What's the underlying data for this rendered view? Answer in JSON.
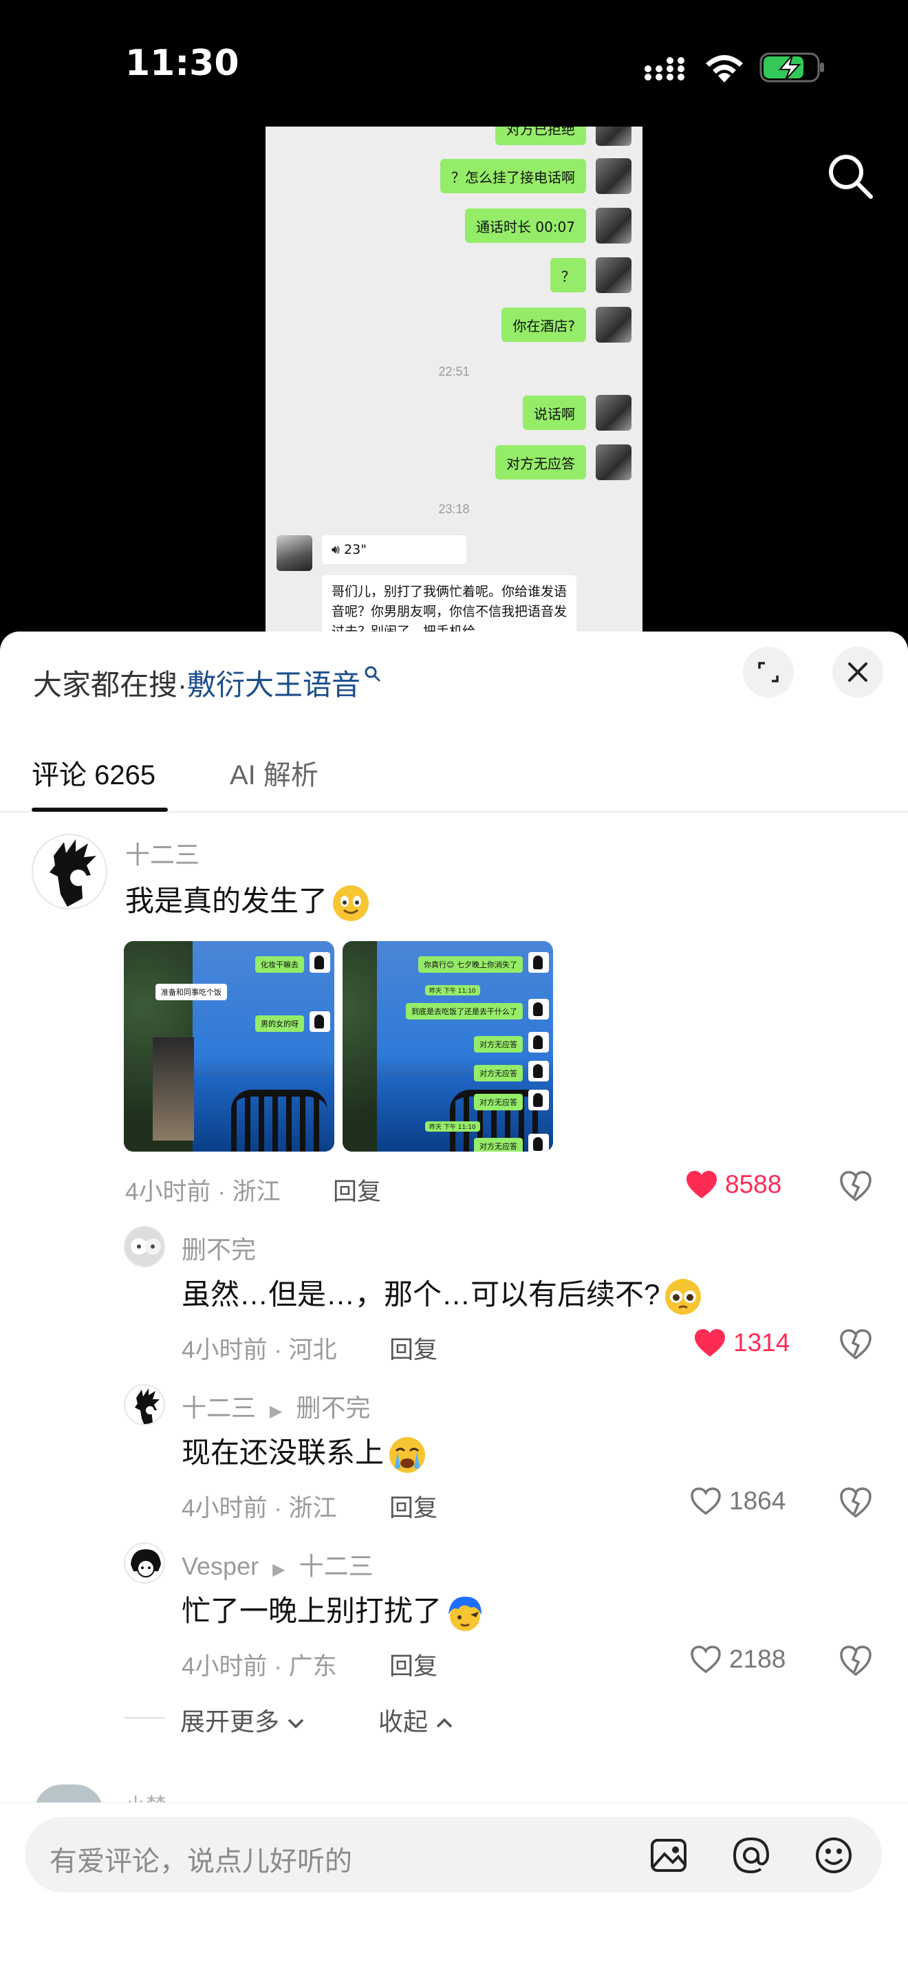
{
  "status": {
    "time": "11:30"
  },
  "video": {
    "messages_right": [
      {
        "text": "对方已拒绝"
      },
      {
        "text": "？怎么挂了接电话啊"
      },
      {
        "text": "通话时长 00:07"
      },
      {
        "text": "？"
      },
      {
        "text": "你在酒店?"
      },
      {
        "text": "说话啊"
      },
      {
        "text": "对方无应答"
      }
    ],
    "times": [
      "22:51",
      "23:18"
    ],
    "voice": "23\"",
    "left_message": "哥们儿，别打了我俩忙着呢。你给谁发语音呢？你男朋友啊，你信不信我把语音发过去？别闹了，把手机给"
  },
  "search_hint": {
    "prefix": "大家都在搜·",
    "keyword": "敷衍大王语音"
  },
  "tabs": [
    {
      "label": "评论 6265",
      "active": true
    },
    {
      "label": "AI 解析",
      "active": false
    }
  ],
  "comments": {
    "main": {
      "user": "十二三",
      "text": "我是真的发生了",
      "meta": "4小时前 · 浙江",
      "reply": "回复",
      "likes": "8588",
      "thumb1": {
        "msgs": [
          "化妆干嘛去",
          "准备和同事吃个饭",
          "男的女的呀"
        ]
      },
      "thumb2": {
        "msgs": [
          "你真行😊 七夕晚上你消失了",
          "昨天 下午 11:10",
          "到底是去吃饭了还是去干什么了",
          "对方无应答",
          "对方无应答",
          "对方无应答",
          "昨天 下午 11:10",
          "对方无应答"
        ]
      }
    },
    "replies": [
      {
        "user": "删不完",
        "to": "",
        "text": "虽然…但是…，那个…可以有后续不?",
        "meta": "4小时前 · 河北",
        "reply": "回复",
        "likes": "1314",
        "liked": true
      },
      {
        "user": "十二三",
        "to": "删不完",
        "text": "现在还没联系上",
        "meta": "4小时前 · 浙江",
        "reply": "回复",
        "likes": "1864",
        "liked": false
      },
      {
        "user": "Vesper",
        "to": "十二三",
        "text": "忙了一晚上别打扰了",
        "meta": "4小时前 · 广东",
        "reply": "回复",
        "likes": "2188",
        "liked": false
      }
    ],
    "expand": "展开更多",
    "collapse": "收起",
    "next_user": "小禁"
  },
  "composer": {
    "placeholder": "有爱评论，说点儿好听的"
  },
  "colors": {
    "like_red": "#fe2c55",
    "link_blue": "#1d4f8c",
    "bubble_green": "#95ec69",
    "charge_green": "#34c759"
  },
  "icons": [
    "search-icon",
    "fullscreen-icon",
    "close-icon",
    "heart-icon",
    "dislike-icon",
    "image-icon",
    "at-icon",
    "emoji-icon"
  ]
}
